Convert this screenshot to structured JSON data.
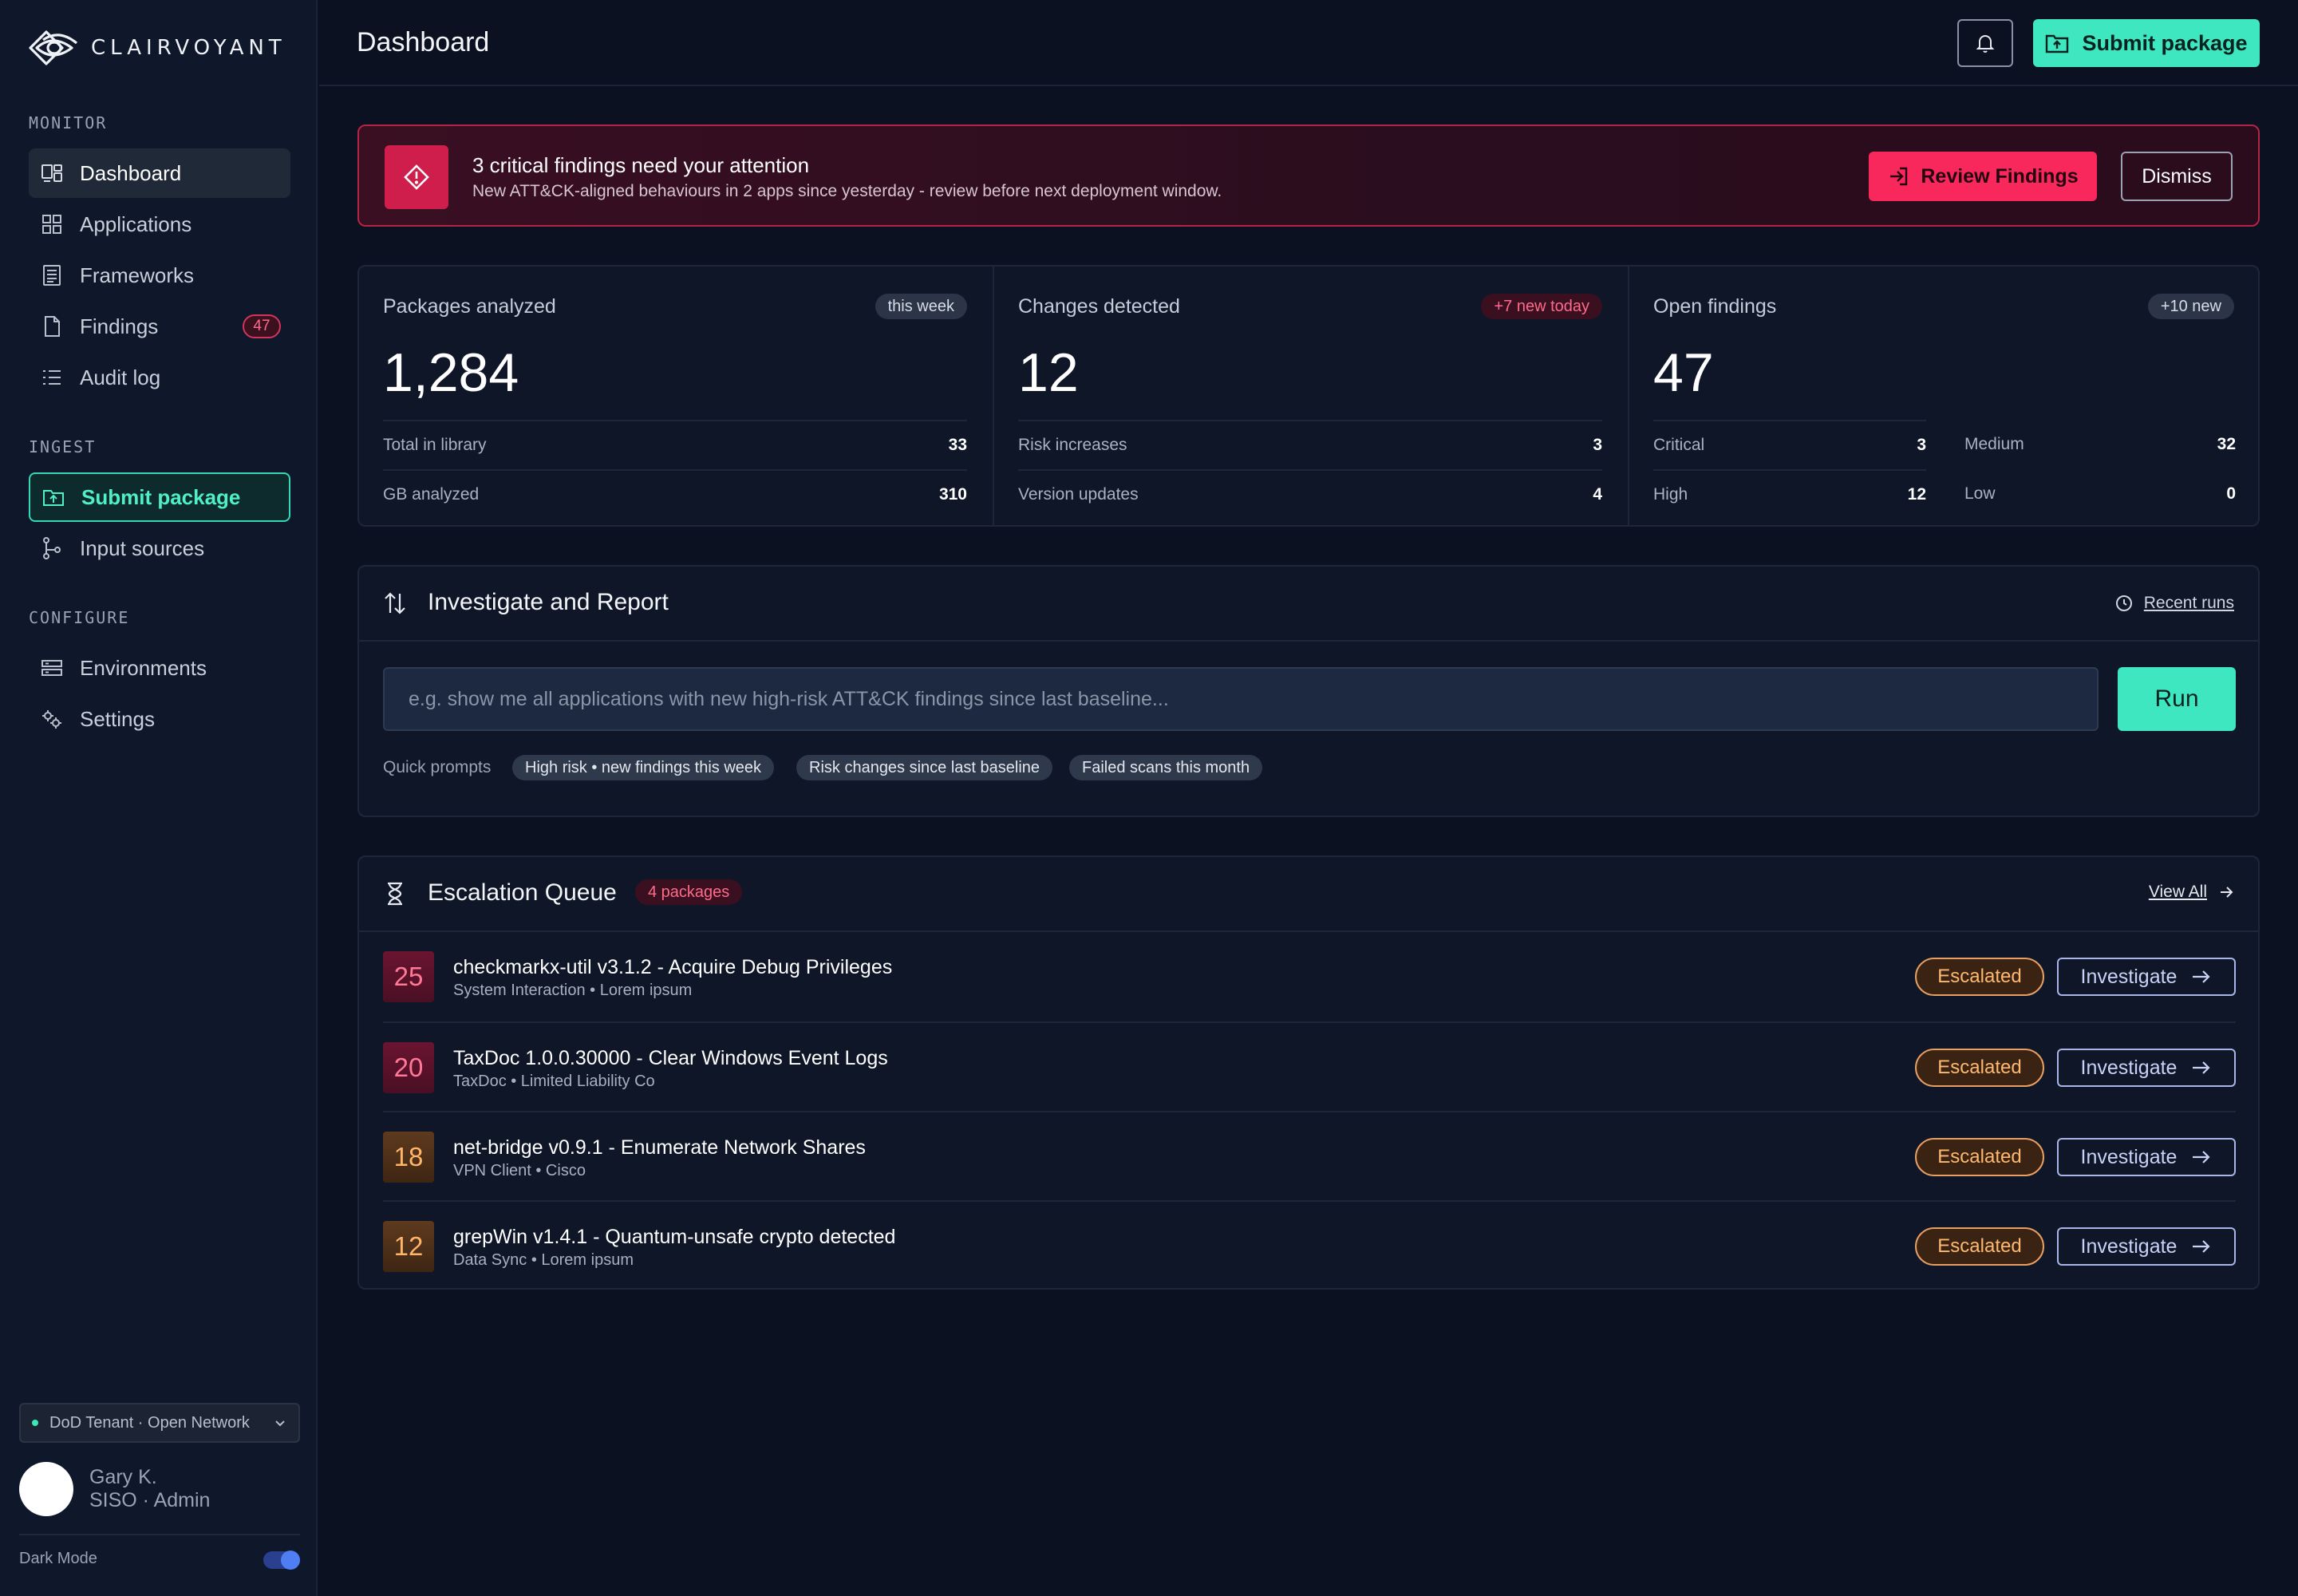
{
  "brand": {
    "name": "CLAIRVOYANT"
  },
  "sidebar": {
    "sections": [
      {
        "title": "MONITOR"
      },
      {
        "title": "INGEST"
      },
      {
        "title": "CONFIGURE"
      }
    ],
    "items": [
      {
        "label": "Dashboard",
        "icon": "dashboard-icon",
        "active": true
      },
      {
        "label": "Applications",
        "icon": "grid-icon"
      },
      {
        "label": "Frameworks",
        "icon": "document-list-icon"
      },
      {
        "label": "Findings",
        "icon": "file-icon",
        "badge": "47"
      },
      {
        "label": "Audit log",
        "icon": "list-icon"
      },
      {
        "label": "Submit package",
        "icon": "folder-upload-icon",
        "primary": true
      },
      {
        "label": "Input sources",
        "icon": "branch-icon"
      },
      {
        "label": "Environments",
        "icon": "server-icon"
      },
      {
        "label": "Settings",
        "icon": "gears-icon"
      }
    ],
    "tenant": "DoD Tenant · Open Network",
    "user": {
      "name": "Gary K.",
      "role": "SISO · Admin"
    },
    "dark_mode_label": "Dark Mode",
    "dark_mode_on": true
  },
  "header": {
    "title": "Dashboard",
    "submit_label": "Submit package"
  },
  "alert": {
    "title": "3 critical findings need your attention",
    "subtitle": "New ATT&CK-aligned behaviours in 2 apps since yesterday - review before next deployment window.",
    "review_label": "Review Findings",
    "dismiss_label": "Dismiss"
  },
  "stats": {
    "packages": {
      "label": "Packages analyzed",
      "pill": "this week",
      "value": "1,284",
      "rows": [
        {
          "label": "Total in library",
          "value": "33"
        },
        {
          "label": "GB analyzed",
          "value": "310"
        }
      ]
    },
    "changes": {
      "label": "Changes detected",
      "pill": "+7 new today",
      "value": "12",
      "rows": [
        {
          "label": "Risk increases",
          "value": "3"
        },
        {
          "label": "Version updates",
          "value": "4"
        }
      ]
    },
    "findings": {
      "label": "Open findings",
      "pill": "+10 new",
      "value": "47",
      "rows": [
        {
          "label": "Critical",
          "value": "3"
        },
        {
          "label": "Medium",
          "value": "32"
        },
        {
          "label": "High",
          "value": "12"
        },
        {
          "label": "Low",
          "value": "0"
        }
      ]
    }
  },
  "investigate": {
    "title": "Investigate and Report",
    "recent_runs_label": "Recent runs",
    "query_placeholder": "e.g. show me all applications with new high-risk ATT&CK findings since last baseline...",
    "query_value": "",
    "run_label": "Run",
    "quick_label": "Quick prompts",
    "quick_prompts": [
      "High risk • new findings this week",
      "Risk changes since last baseline",
      "Failed scans this month"
    ]
  },
  "escalation": {
    "title": "Escalation Queue",
    "count": "4 packages",
    "view_all_label": "View All",
    "status_label": "Escalated",
    "action_label": "Investigate",
    "rows": [
      {
        "score": "25",
        "severity": "red",
        "title": "checkmarkx-util v3.1.2 - Acquire Debug Privileges",
        "subtitle": "System Interaction • Lorem ipsum"
      },
      {
        "score": "20",
        "severity": "red",
        "title": "TaxDoc 1.0.0.30000 - Clear Windows Event Logs",
        "subtitle": "TaxDoc • Limited Liability Co"
      },
      {
        "score": "18",
        "severity": "amber",
        "title": "net-bridge v0.9.1 - Enumerate Network Shares",
        "subtitle": "VPN Client • Cisco"
      },
      {
        "score": "12",
        "severity": "amber",
        "title": "grepWin v1.4.1 - Quantum-unsafe crypto detected",
        "subtitle": "Data Sync • Lorem ipsum"
      }
    ]
  },
  "colors": {
    "accent": "#3ee7c0",
    "critical": "#f8275c",
    "escalated": "#ffb870",
    "background": "#0b1120"
  }
}
